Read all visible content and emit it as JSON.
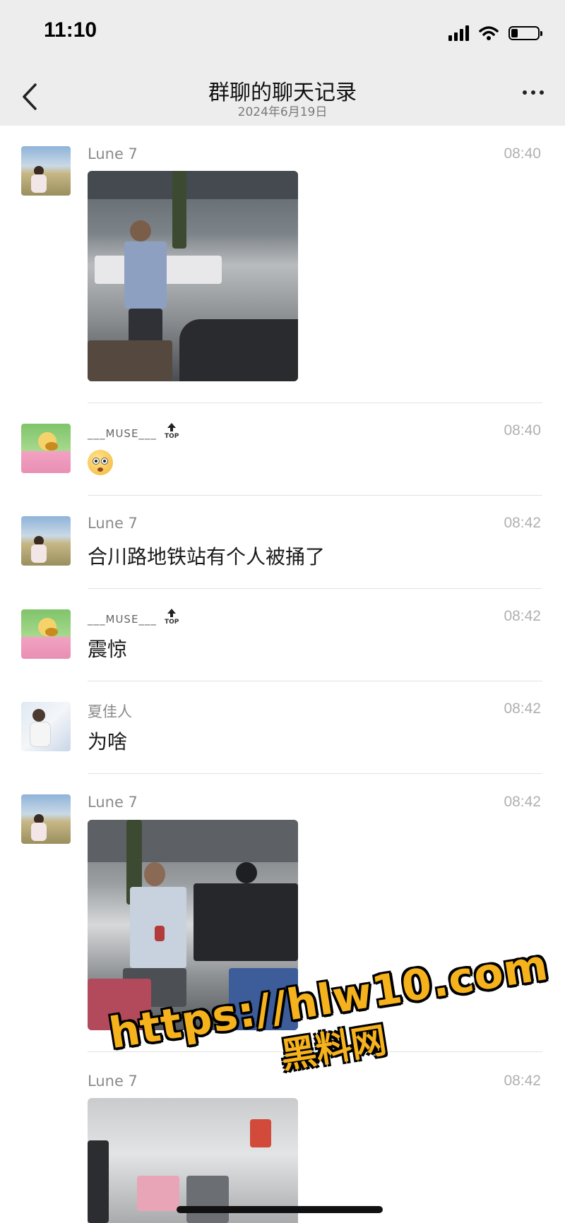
{
  "status_bar": {
    "time": "11:10"
  },
  "nav": {
    "title": "群聊的聊天记录",
    "subtitle": "2024年6月19日",
    "back_icon": "chevron-left-icon",
    "more_icon": "more-dots-icon"
  },
  "messages": [
    {
      "sender": "Lune 7",
      "time": "08:40",
      "type": "image"
    },
    {
      "sender": "___MUSE___",
      "badge": "TOP",
      "time": "08:40",
      "type": "emoji",
      "emoji": "flushed-face"
    },
    {
      "sender": "Lune 7",
      "time": "08:42",
      "text": "合川路地铁站有个人被捅了"
    },
    {
      "sender": "___MUSE___",
      "badge": "TOP",
      "time": "08:42",
      "text": "震惊"
    },
    {
      "sender": "夏佳人",
      "time": "08:42",
      "text": "为啥"
    },
    {
      "sender": "Lune 7",
      "time": "08:42",
      "type": "image"
    },
    {
      "sender": "Lune 7",
      "time": "08:42",
      "type": "image"
    }
  ],
  "watermark": {
    "url": "https://hlw10.com",
    "text": "黑料网"
  },
  "colors": {
    "nav_bg": "#ededed",
    "watermark": "#f5b21c",
    "time_gray": "#b0b0b0"
  }
}
